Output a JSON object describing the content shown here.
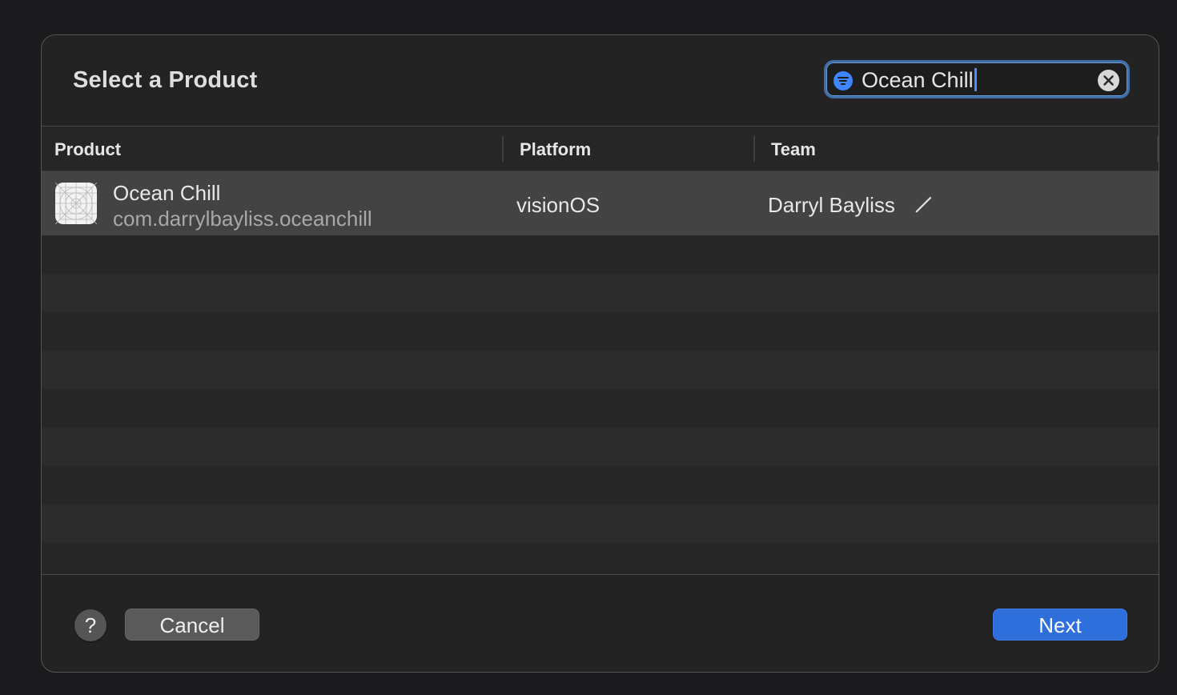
{
  "dialog": {
    "title": "Select a Product"
  },
  "search": {
    "value": "Ocean Chill",
    "filter_icon": "filter-icon",
    "clear_icon": "clear-icon",
    "accent_color": "#3e85ff"
  },
  "table": {
    "columns": [
      "Product",
      "Platform",
      "Team"
    ],
    "rows": [
      {
        "icon": "app-icon",
        "name": "Ocean Chill",
        "bundle_id": "com.darrylbayliss.oceanchill",
        "platform": "visionOS",
        "team": "Darryl Bayliss",
        "edit_icon": "pencil-icon",
        "selected": true
      }
    ]
  },
  "footer": {
    "help_label": "?",
    "cancel_label": "Cancel",
    "next_label": "Next",
    "next_color": "#2f6fdc"
  }
}
